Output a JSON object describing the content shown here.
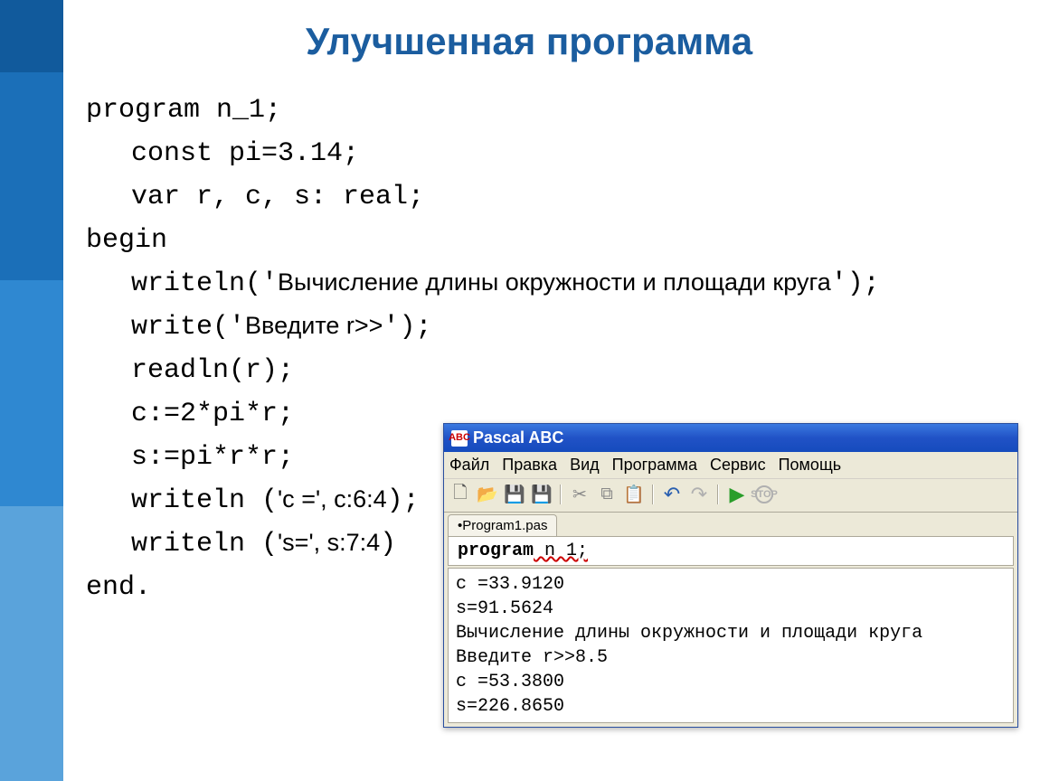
{
  "slide": {
    "title": "Улучшенная программа"
  },
  "code": {
    "l1": "program n_1;",
    "l2": "const pi=3.14;",
    "l3": "var r, c, s: real;",
    "l4": "begin",
    "l5_pre": "writeln('",
    "l5_mix": "Вычисление длины окружности и площади круга",
    "l5_post": "');",
    "l6_pre": "write('",
    "l6_mix": "Введите r>>",
    "l6_post": "');",
    "l7": "readln(r);",
    "l8": "c:=2*pi*r;",
    "l9": "s:=pi*r*r;",
    "l10_pre": "writeln (",
    "l10_mix": "'c =', c:6:4",
    "l10_post": ");",
    "l11_pre": "writeln (",
    "l11_mix": "'s=', s:7:4",
    "l11_post": ")",
    "l12": "end."
  },
  "pascal": {
    "title": "Pascal ABC",
    "menu": {
      "file": "Файл",
      "edit": "Правка",
      "view": "Вид",
      "program": "Программа",
      "service": "Сервис",
      "help": "Помощь"
    },
    "tab": "•Program1.pas",
    "editor_line_kw": "program",
    "editor_line_rest": " n 1;",
    "output": "c =33.9120\ns=91.5624\nВычисление длины окружности и площади круга\nВведите r>>8.5\nc =53.3800\ns=226.8650"
  },
  "icons": {
    "app": "ABC",
    "new": "🗋",
    "open": "📂",
    "save": "💾",
    "saveall": "💾",
    "cut": "✂",
    "copy": "⧉",
    "paste": "📋",
    "undo": "↶",
    "redo": "↷",
    "run": "▶",
    "stop": "STOP"
  }
}
